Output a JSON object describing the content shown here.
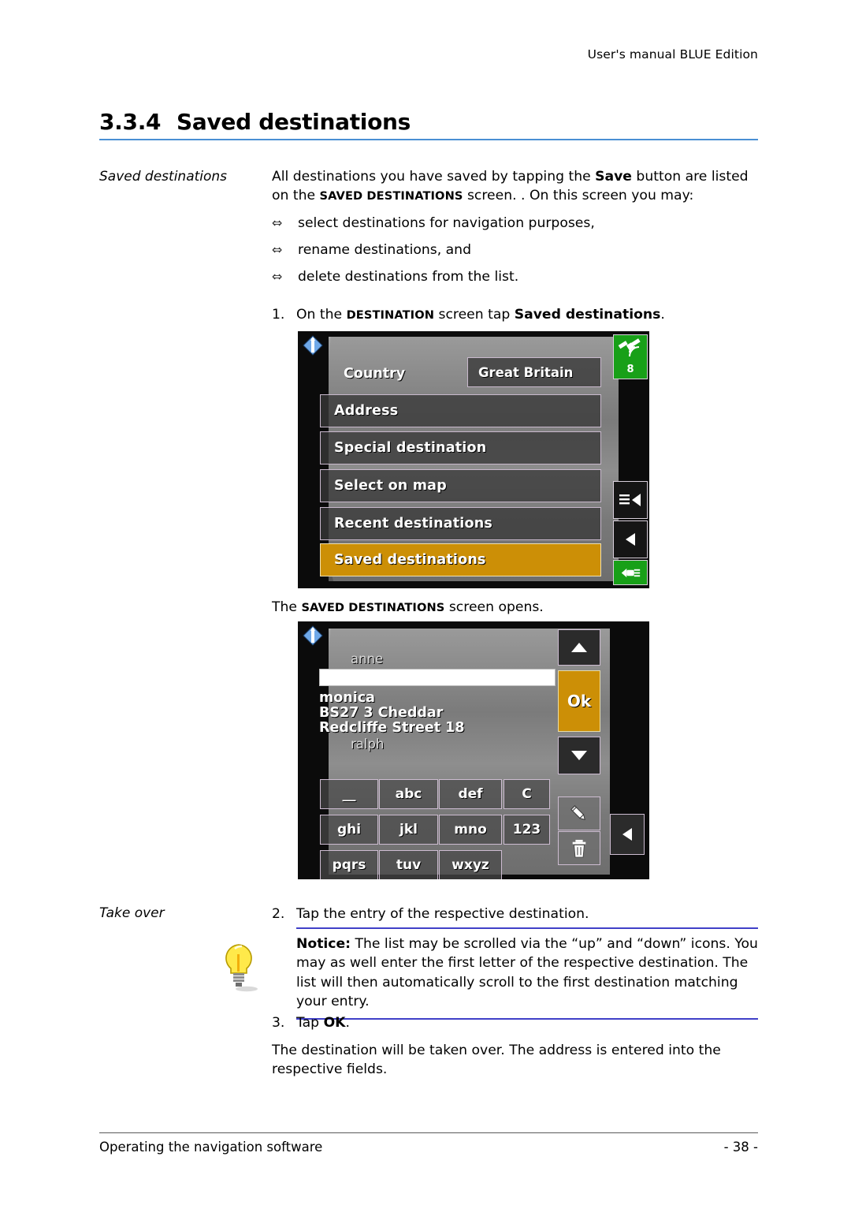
{
  "header": {
    "manual_title": "User's manual BLUE Edition"
  },
  "heading": {
    "number": "3.3.4",
    "title": "Saved destinations"
  },
  "margin_labels": {
    "saved_destinations": "Saved destinations",
    "take_over": "Take over"
  },
  "intro": {
    "line1_a": "All destinations you have saved by tapping the ",
    "line1_save": "Save",
    "line1_b": " button are listed on the ",
    "line1_sc": "Saved destinations",
    "line1_c": " screen. . On this screen you may:"
  },
  "bullets": {
    "glyph": "⇔",
    "items": [
      "select destinations for navigation purposes,",
      "rename destinations, and",
      "delete destinations from the list."
    ]
  },
  "steps": {
    "one": {
      "number": "1.",
      "a": "On the ",
      "sc": "Destination",
      "b": " screen tap ",
      "bold": "Saved destinations",
      "c": "."
    },
    "caption_between": {
      "a": "The ",
      "sc": "Saved destinations",
      "b": " screen opens."
    },
    "two": {
      "number": "2.",
      "text": "Tap the entry of the respective destination."
    },
    "three": {
      "number": "3.",
      "a": "Tap ",
      "bold": "OK",
      "b": "."
    },
    "result": "The destination will be taken over. The address is entered into the respective fields."
  },
  "notice": {
    "label": "Notice:",
    "text": " The list may be scrolled via the “up” and “down” icons. You may as well enter the first letter of the respective destination. The list will then automatically scroll to the first destination matching your entry."
  },
  "footer": {
    "left": "Operating the navigation software",
    "page": "- 38 -"
  },
  "screenshot_destination": {
    "country_label": "Country",
    "country_value": "Great Britain",
    "menu_items": [
      "Address",
      "Special destination",
      "Select on map",
      "Recent destinations",
      "Saved destinations"
    ],
    "selected_item": "Saved destinations",
    "gps_satellites": "8",
    "icons": {
      "compass": "compass-icon",
      "gps": "gps-satellite-icon",
      "menu": "menu-back-icon",
      "back": "back-arrow-icon",
      "power": "power-plug-icon"
    },
    "colors": {
      "selected": "#cc8f06",
      "status_green": "#18a018"
    }
  },
  "screenshot_saved": {
    "entries_above": "anne",
    "entry_name": "monica",
    "entry_postcode_city": "BS27 3 Cheddar",
    "entry_street": "Redcliffe Street 18",
    "entries_below": "ralph",
    "input_value": "",
    "ok_label": "Ok",
    "keys": [
      "__",
      "abc",
      "def",
      "C",
      "ghi",
      "jkl",
      "mno",
      "123",
      "pqrs",
      "tuv",
      "wxyz"
    ],
    "icons": {
      "compass": "compass-icon",
      "scroll_up": "scroll-up-icon",
      "scroll_down": "scroll-down-icon",
      "rename": "pencil-icon",
      "delete": "trash-icon",
      "back": "back-arrow-icon"
    },
    "colors": {
      "ok": "#cc8f06"
    }
  }
}
